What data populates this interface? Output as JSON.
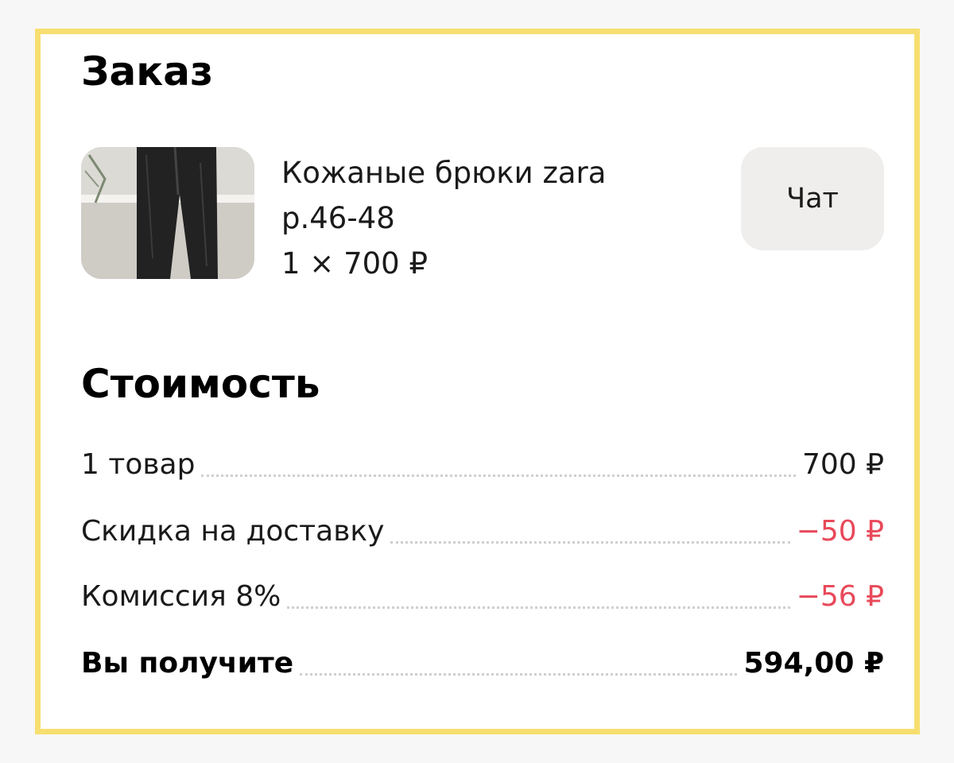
{
  "order": {
    "title": "Заказ",
    "item": {
      "name": "Кожаные брюки zara",
      "size": "р.46-48",
      "quantity_price": "1 × 700 ₽"
    },
    "chat_label": "Чат"
  },
  "cost": {
    "title": "Стоимость",
    "rows": [
      {
        "label": "1 товар",
        "value": "700 ₽"
      },
      {
        "label": "Скидка на доставку",
        "value": "−50 ₽"
      },
      {
        "label": "Комиссия 8%",
        "value": "−56 ₽"
      },
      {
        "label": "Вы получите",
        "value": "594,00 ₽"
      }
    ]
  },
  "colors": {
    "frame": "#f7de70",
    "negative": "#e8495a",
    "chat_button_bg": "#efeeec"
  },
  "icons": {
    "thumbnail": "leather-pants-photo"
  }
}
